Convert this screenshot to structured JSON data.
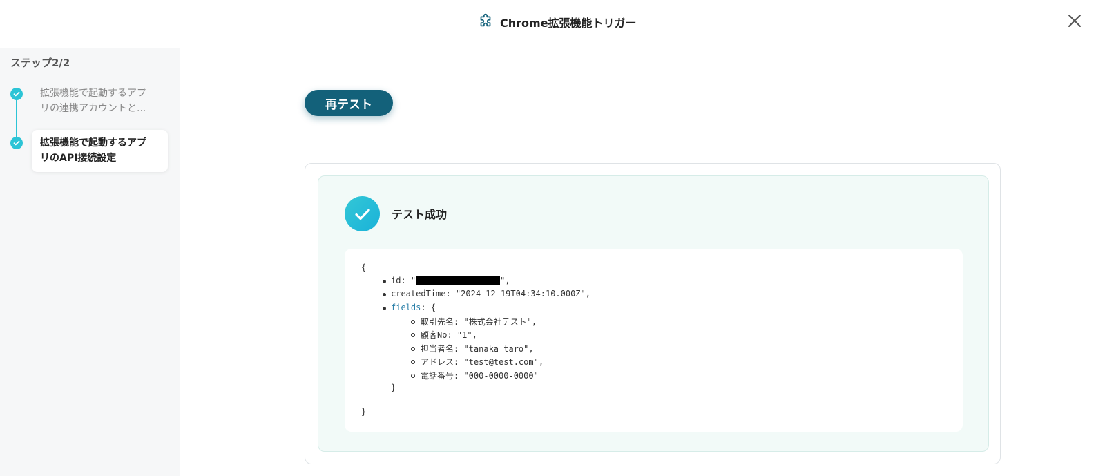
{
  "header": {
    "title": "Chrome拡張機能トリガー",
    "icon": "puzzle-icon",
    "close_icon": "close-icon"
  },
  "sidebar": {
    "step_counter": "ステップ2/2",
    "steps": [
      {
        "label": "拡張機能で起動するアプリの連携アカウントと...",
        "line1": "拡張機能で起動するアプ",
        "line2": "リの連携アカウントと...",
        "status": "complete"
      },
      {
        "label": "拡張機能で起動するアプリのAPI接続設定",
        "line1": "拡張機能で起動するアプ",
        "line2": "リのAPI接続設定",
        "status": "current"
      }
    ]
  },
  "main": {
    "retest_label": "再テスト",
    "result": {
      "status_text": "テスト成功",
      "json": {
        "open_brace": "{",
        "close_brace": "}",
        "fields_close": "}",
        "id_key": "id: \"",
        "id_tail": "\",",
        "created_line": "createdTime: \"2024-12-19T04:34:10.000Z\",",
        "fields_key": "fields",
        "fields_tail": ": {",
        "fields": [
          "取引先名: \"株式会社テスト\",",
          "顧客No: \"1\",",
          "担当者名: \"tanaka taro\",",
          "アドレス: \"test@test.com\",",
          "電話番号: \"000-0000-0000\""
        ]
      }
    }
  },
  "colors": {
    "accent": "#2cc4d6",
    "button": "#13617a",
    "success_bg": "#f2faf8"
  }
}
